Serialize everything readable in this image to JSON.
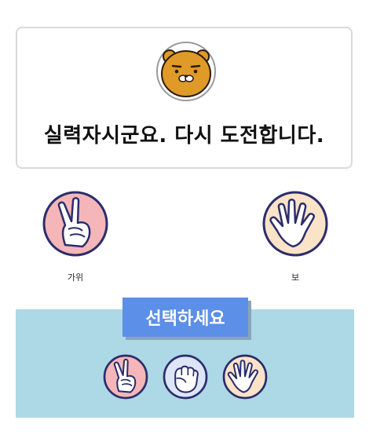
{
  "result": {
    "message": "실력자시군요. 다시 도전합니다."
  },
  "player_hand": {
    "label": "가위",
    "icon": "scissors-hand-icon"
  },
  "computer_hand": {
    "label": "보",
    "icon": "paper-hand-icon"
  },
  "panel": {
    "title": "선택하세요",
    "choices": [
      "scissors-hand-icon",
      "rock-hand-icon",
      "paper-hand-icon"
    ]
  },
  "colors": {
    "scissors_bg": "#f4b6b8",
    "rock_bg": "#dde6f7",
    "paper_bg": "#fbe3c8",
    "outline": "#2b2d6b",
    "panel_bg": "#add8e6",
    "button_bg": "#5b8fe8",
    "avatar_fur": "#e09a28"
  }
}
